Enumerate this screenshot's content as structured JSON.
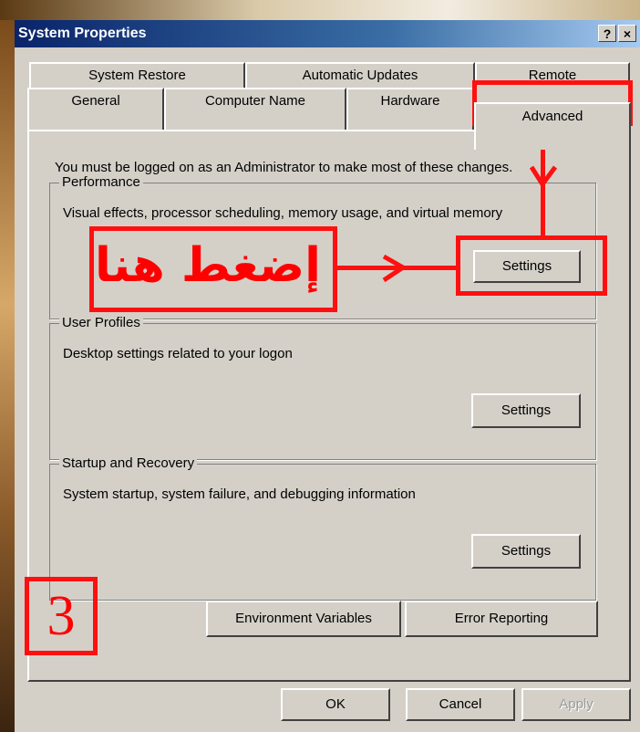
{
  "window": {
    "title": "System Properties",
    "help_btn": "?",
    "close_btn": "×"
  },
  "tabs": {
    "row1": [
      "System Restore",
      "Automatic Updates",
      "Remote"
    ],
    "row2": [
      "General",
      "Computer Name",
      "Hardware",
      "Advanced"
    ],
    "active": "Advanced"
  },
  "notice": "You must be logged on as an Administrator to make most of these changes.",
  "groups": {
    "performance": {
      "label": "Performance",
      "description": "Visual effects, processor scheduling, memory usage, and virtual memory",
      "button": "Settings"
    },
    "user_profiles": {
      "label": "User Profiles",
      "description": "Desktop settings related to your logon",
      "button": "Settings"
    },
    "startup": {
      "label": "Startup and Recovery",
      "description": "System startup, system failure, and debugging information",
      "button": "Settings"
    }
  },
  "buttons": {
    "env_vars": "Environment Variables",
    "error_reporting": "Error Reporting",
    "ok": "OK",
    "cancel": "Cancel",
    "apply": "Apply"
  },
  "annotation": {
    "arabic_text": "إضغط هنا",
    "step_number": "3",
    "color": "#ff1010"
  }
}
